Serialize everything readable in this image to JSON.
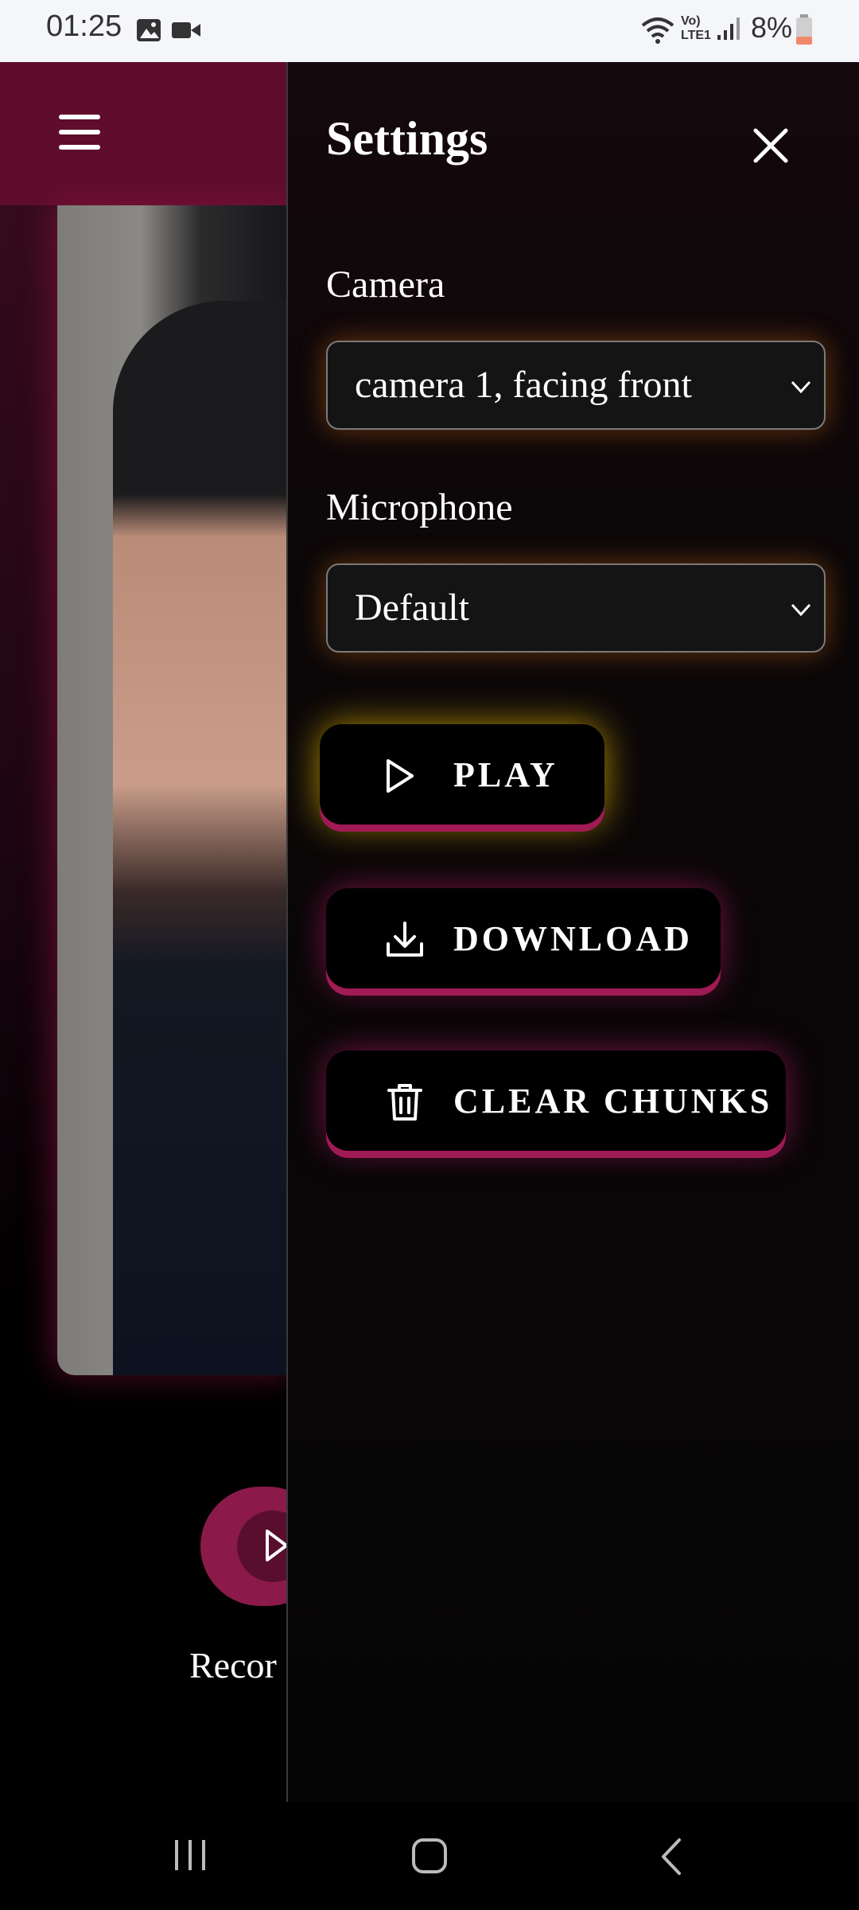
{
  "status_bar": {
    "time": "01:25",
    "battery": "8%",
    "network_label": "Vo) LTE1"
  },
  "app": {
    "record_label": "Recor"
  },
  "drawer": {
    "title": "Settings",
    "camera_label": "Camera",
    "camera_value": "camera 1, facing front",
    "microphone_label": "Microphone",
    "microphone_value": "Default",
    "buttons": {
      "play": "PLAY",
      "download": "DOWNLOAD",
      "clear_chunks": "CLEAR CHUNKS"
    }
  },
  "colors": {
    "accent": "#a01a55",
    "header": "#5e0d2c",
    "play_glow": "#e6b400",
    "select_glow": "#dc6e14"
  }
}
